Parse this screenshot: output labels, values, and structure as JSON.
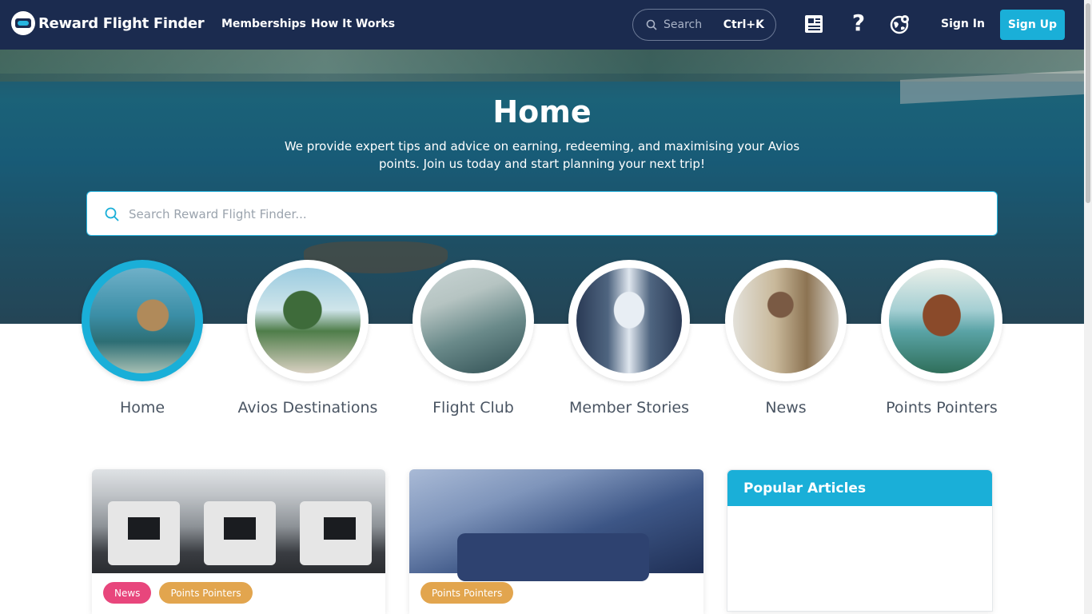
{
  "header": {
    "logo_text": "Reward Flight Finder",
    "nav": [
      {
        "label": "Memberships"
      },
      {
        "label": "How It Works"
      }
    ],
    "search": {
      "placeholder": "Search",
      "shortcut": "Ctrl+K"
    },
    "icons": [
      "news-icon",
      "help-icon",
      "globe-icon"
    ],
    "help_glyph": "?",
    "sign_in": "Sign In",
    "sign_up": "Sign Up"
  },
  "hero": {
    "title": "Home",
    "subtitle": "We provide expert tips and advice on earning, redeeming, and maximising your Avios points. Join us today and start planning your next trip!",
    "search_placeholder": "Search Reward Flight Finder..."
  },
  "categories": [
    {
      "label": "Home",
      "active": true
    },
    {
      "label": "Avios Destinations",
      "active": false
    },
    {
      "label": "Flight Club",
      "active": false
    },
    {
      "label": "Member Stories",
      "active": false
    },
    {
      "label": "News",
      "active": false
    },
    {
      "label": "Points Pointers",
      "active": false
    }
  ],
  "cards": [
    {
      "tags": [
        "News",
        "Points Pointers"
      ]
    },
    {
      "tags": [
        "Points Pointers"
      ]
    }
  ],
  "popular": {
    "title": "Popular Articles"
  },
  "colors": {
    "header_bg": "#1b2b4f",
    "accent": "#1aafd8",
    "tag_news": "#e8467c",
    "tag_points": "#e2a54e"
  }
}
